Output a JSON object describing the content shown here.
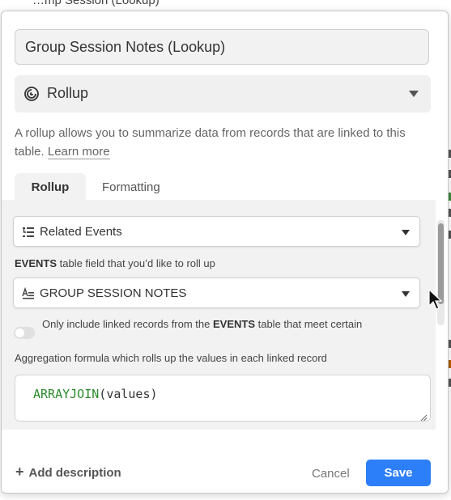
{
  "background": {
    "top_text": "…mp Session  (Lookup)"
  },
  "dialog": {
    "field_name": "Group Session Notes (Lookup)",
    "field_type": {
      "icon": "rollup-spiral-icon",
      "label": "Rollup"
    },
    "description": {
      "text": "A rollup allows you to summarize data from records that are linked to this table.",
      "learn_more": "Learn more"
    },
    "tabs": [
      {
        "label": "Rollup",
        "active": true
      },
      {
        "label": "Formatting",
        "active": false
      }
    ],
    "linked_field": {
      "icon": "linked-record-icon",
      "value": "Related Events"
    },
    "rollup_field_label": {
      "table": "EVENTS",
      "rest": " table field that you’d like to roll up"
    },
    "rollup_field": {
      "icon": "long-text-icon",
      "value": "GROUP SESSION NOTES"
    },
    "conditions": {
      "prefix": "Only include linked records from the ",
      "table": "EVENTS",
      "suffix": " table that meet certain conditions",
      "enabled": false
    },
    "aggregation_label": "Aggregation formula which rolls up the values in each linked record",
    "formula": {
      "function": "ARRAYJOIN",
      "open": "(",
      "arg": "values",
      "close": ")"
    },
    "footer": {
      "add_description": "Add description",
      "cancel": "Cancel",
      "save": "Save"
    }
  },
  "colors": {
    "accent": "#2d7ff9",
    "formula_function": "#2b8a2b"
  }
}
